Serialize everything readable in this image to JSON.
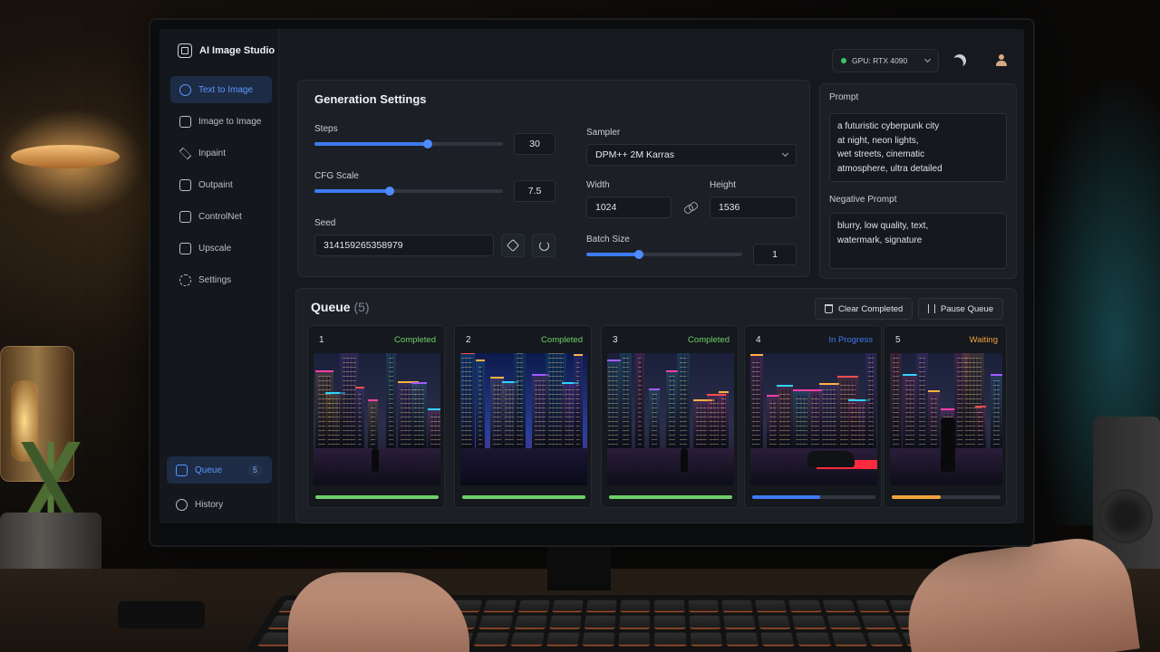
{
  "app": {
    "title": "AI Image Studio"
  },
  "sidebar": {
    "items": [
      {
        "label": "Text to Image",
        "icon": "text-to-image-icon",
        "active": true
      },
      {
        "label": "Image to Image",
        "icon": "image-to-image-icon"
      },
      {
        "label": "Inpaint",
        "icon": "brush-icon"
      },
      {
        "label": "Outpaint",
        "icon": "expand-icon"
      },
      {
        "label": "ControlNet",
        "icon": "controlnet-icon"
      },
      {
        "label": "Upscale",
        "icon": "upscale-icon"
      },
      {
        "label": "Settings",
        "icon": "gear-icon"
      }
    ],
    "bottom": [
      {
        "label": "Queue",
        "icon": "queue-icon",
        "badge": "5",
        "active": true
      },
      {
        "label": "History",
        "icon": "clock-icon"
      }
    ]
  },
  "topbar": {
    "gpu_label": "GPU: RTX 4090",
    "gpu_status_color": "#3ec46d"
  },
  "generation": {
    "title": "Generation Settings",
    "steps": {
      "label": "Steps",
      "value": "30",
      "fraction": 0.6
    },
    "cfg": {
      "label": "CFG Scale",
      "value": "7.5",
      "fraction": 0.4
    },
    "seed": {
      "label": "Seed",
      "value": "314159265358979"
    },
    "sampler": {
      "label": "Sampler",
      "value": "DPM++ 2M Karras"
    },
    "width": {
      "label": "Width",
      "value": "1024"
    },
    "height": {
      "label": "Height",
      "value": "1536"
    },
    "batch": {
      "label": "Batch Size",
      "value": "1",
      "fraction": 0.34
    }
  },
  "prompt": {
    "label": "Prompt",
    "lines": [
      "a futuristic cyberpunk city",
      "at night, neon lights,",
      "wet streets, cinematic",
      "atmosphere, ultra detailed"
    ],
    "negative_label": "Negative Prompt",
    "negative_lines": [
      "blurry, low quality, text,",
      "watermark, signature"
    ]
  },
  "queue": {
    "title": "Queue",
    "count": "(5)",
    "clear_label": "Clear Completed",
    "pause_label": "Pause Queue",
    "items": [
      {
        "num": "1",
        "status": "Completed",
        "color": "#6fcf6a",
        "progress": 1.0
      },
      {
        "num": "2",
        "status": "Completed",
        "color": "#6fcf6a",
        "progress": 1.0
      },
      {
        "num": "3",
        "status": "Completed",
        "color": "#6fcf6a",
        "progress": 1.0
      },
      {
        "num": "4",
        "status": "In Progress",
        "color": "#3d7bf0",
        "progress": 0.55
      },
      {
        "num": "5",
        "status": "Waiting",
        "color": "#f0a33c",
        "progress": 0.45
      }
    ]
  }
}
